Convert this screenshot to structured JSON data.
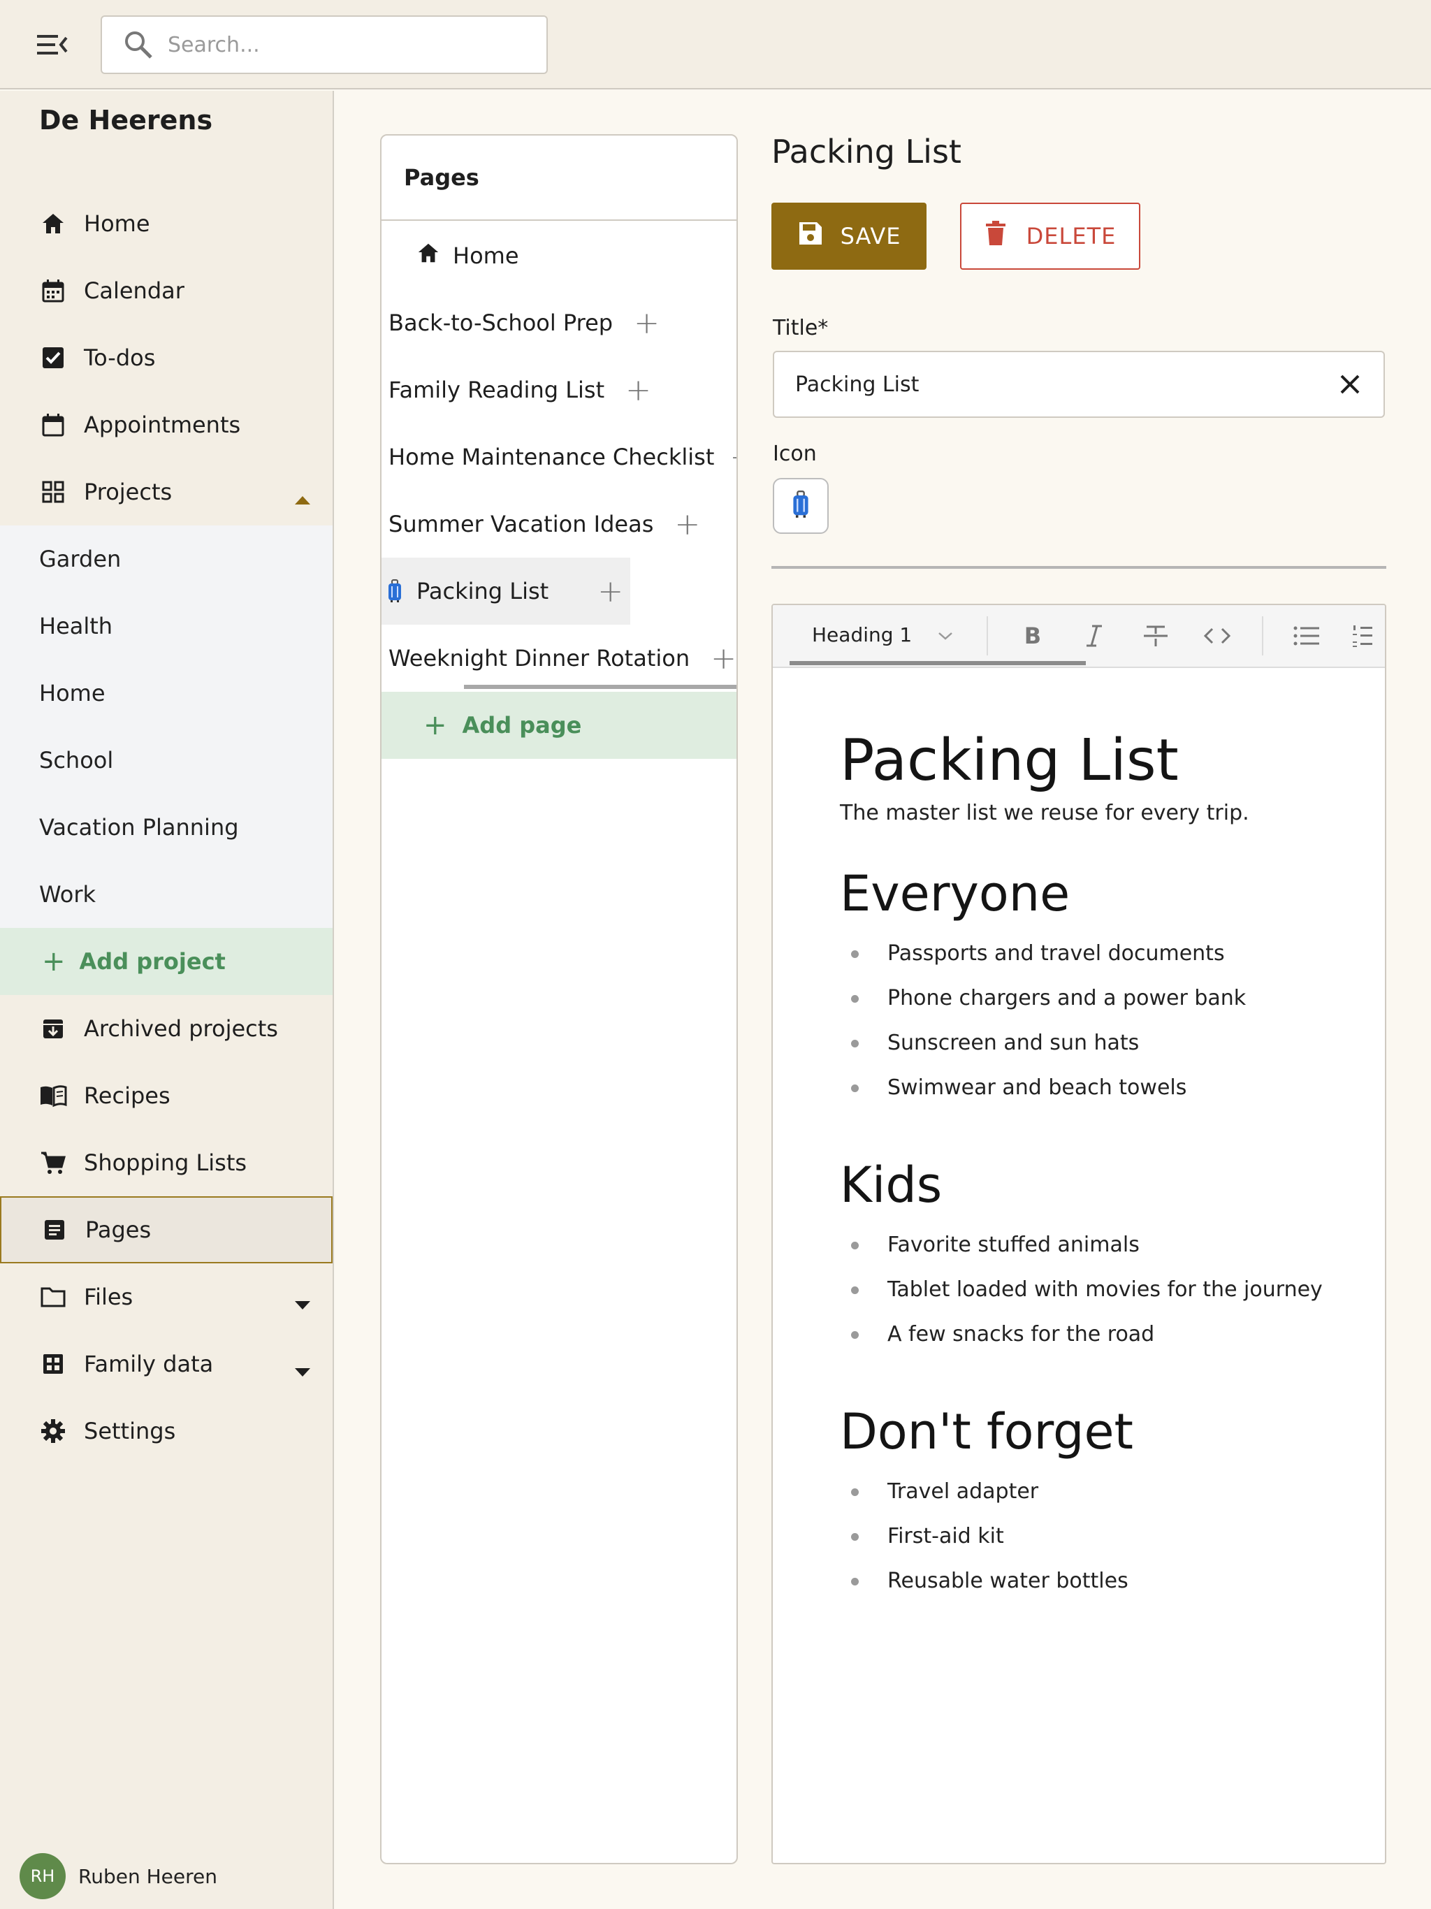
{
  "search": {
    "placeholder": "Search..."
  },
  "sidebar": {
    "brand": "De Heerens",
    "items": [
      {
        "label": "Home"
      },
      {
        "label": "Calendar"
      },
      {
        "label": "To-dos"
      },
      {
        "label": "Appointments"
      },
      {
        "label": "Projects"
      }
    ],
    "projects": [
      "Garden",
      "Health",
      "Home",
      "School",
      "Vacation Planning",
      "Work"
    ],
    "add_project": "Add project",
    "items2": [
      {
        "label": "Archived projects"
      },
      {
        "label": "Recipes"
      },
      {
        "label": "Shopping Lists"
      },
      {
        "label": "Pages"
      },
      {
        "label": "Files"
      },
      {
        "label": "Family data"
      },
      {
        "label": "Settings"
      }
    ],
    "active": "Pages"
  },
  "user": {
    "initials": "RH",
    "name": "Ruben Heeren"
  },
  "pages_panel": {
    "header": "Pages",
    "home": "Home",
    "pages": [
      "Back-to-School Prep",
      "Family Reading List",
      "Home Maintenance Checklist",
      "Summer Vacation Ideas",
      "Packing List",
      "Weeknight Dinner Rotation"
    ],
    "selected": "Packing List",
    "add_page": "Add page"
  },
  "editor": {
    "page_title": "Packing List",
    "save_label": "SAVE",
    "delete_label": "DELETE",
    "title_label": "Title*",
    "title_value": "Packing List",
    "icon_label": "Icon",
    "icon_name": "luggage-icon",
    "toolbar": {
      "block_type": "Heading 1"
    },
    "content": {
      "h1": "Packing List",
      "intro": "The master list we reuse for every trip.",
      "sections": [
        {
          "heading": "Everyone",
          "items": [
            "Passports and travel documents",
            "Phone chargers and a power bank",
            "Sunscreen and sun hats",
            "Swimwear and beach towels"
          ]
        },
        {
          "heading": "Kids",
          "items": [
            "Favorite stuffed animals",
            "Tablet loaded with movies for the journey",
            "A few snacks for the road"
          ]
        },
        {
          "heading": "Don't forget",
          "items": [
            "Travel adapter",
            "First-aid kit",
            "Reusable water bottles"
          ]
        }
      ]
    }
  },
  "colors": {
    "accent": "#8e6a12",
    "danger": "#c9483a",
    "add_green": "#4a8f5a",
    "add_bg": "#dfede0",
    "sidebar_bg": "#f3eee4"
  }
}
